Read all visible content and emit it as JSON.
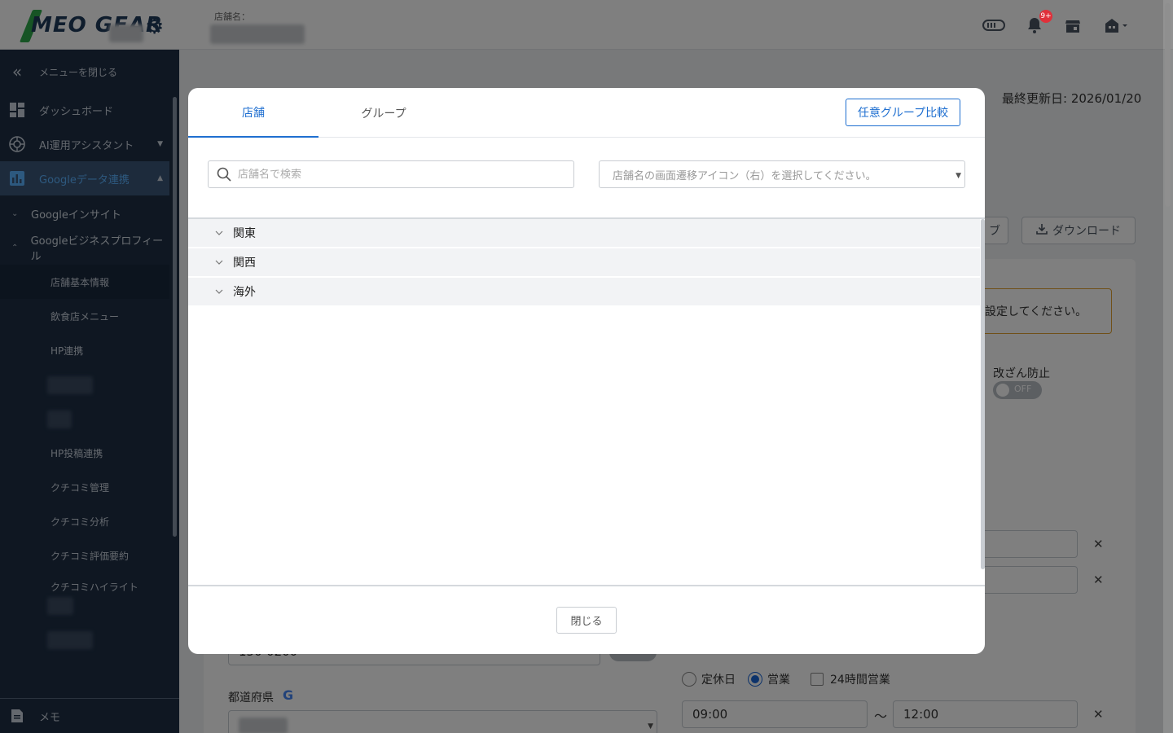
{
  "header": {
    "logo_text": "MEO GEAR",
    "store_label": "店舗名：",
    "notification_badge": "9+"
  },
  "sidebar": {
    "close_menu": "メニューを閉じる",
    "items": [
      {
        "label": "ダッシュボード",
        "icon": "dashboard-icon"
      },
      {
        "label": "AI運用アシスタント",
        "icon": "openai-icon"
      },
      {
        "label": "Googleデータ連携",
        "icon": "bar-chart-icon"
      }
    ],
    "subs": [
      {
        "label": "Googleインサイト"
      },
      {
        "label": "Googleビジネスプロフィール"
      }
    ],
    "leaves": [
      {
        "label": "店舗基本情報"
      },
      {
        "label": "飲食店メニュー"
      },
      {
        "label": "HP連携"
      },
      {
        "label": "HP投稿連携"
      },
      {
        "label": "クチコミ管理"
      },
      {
        "label": "クチコミ分析"
      },
      {
        "label": "クチコミ評価要約"
      },
      {
        "label": "クチコミハイライト"
      }
    ],
    "memo": "メモ"
  },
  "background": {
    "last_updated": "最終更新日: 2026/01/20",
    "button_right_partial": "ブ",
    "download_button": "ダウンロード",
    "warning_partial": "設定してください。",
    "tamper_label": "改ざん防止",
    "tamper_toggle": "OFF",
    "postal_partial": "150-0200",
    "prefecture_label": "都道府県",
    "closed_day": "定休日",
    "open": "営業",
    "all_day": "24時間営業",
    "time_from": "09:00",
    "tilde": "〜",
    "time_to": "12:00"
  },
  "modal": {
    "tabs": [
      {
        "label": "店舗",
        "active": true
      },
      {
        "label": "グループ",
        "active": false
      }
    ],
    "compare_button": "任意グループ比較",
    "search_placeholder": "店舗名で検索",
    "select_placeholder": "店舗名の画面遷移アイコン（右）を選択してください。",
    "groups": [
      {
        "label": "関東"
      },
      {
        "label": "関西"
      },
      {
        "label": "海外"
      }
    ],
    "close_button": "閉じる"
  },
  "colors": {
    "accent": "#1f6fd0",
    "sidebar_bg": "#1e2f45",
    "sidebar_active": "#5bb2ff"
  }
}
